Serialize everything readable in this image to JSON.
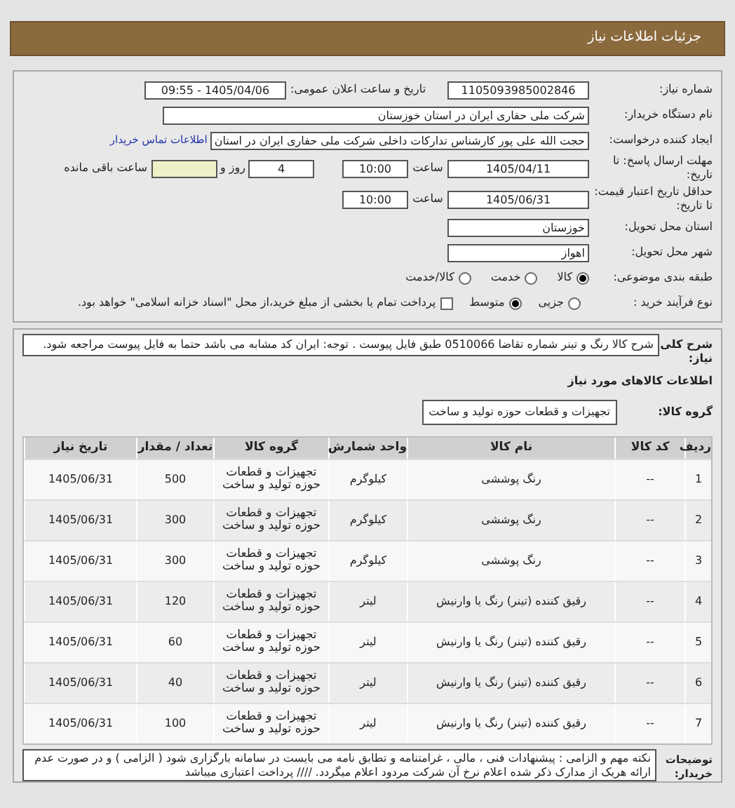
{
  "header": {
    "title": "جزئیات اطلاعات نیاز"
  },
  "details": {
    "need_number": {
      "label": "شماره نیاز:",
      "value": "1105093985002846"
    },
    "announce": {
      "label": "تاریخ و ساعت اعلان عمومی:",
      "value": "1405/04/06 - 09:55"
    },
    "buyer": {
      "label": "نام دستگاه خریدار:",
      "value": "شرکت ملی حفاری ایران در استان خوزستان"
    },
    "creator": {
      "label": "ایجاد کننده درخواست:",
      "value": "حجت الله علی پور کارشناس تدارکات داخلی شرکت ملی حفاری ایران در استان",
      "link": "اطلاعات تماس خریدار"
    },
    "deadline": {
      "label": "مهلت ارسال پاسخ: تا تاریخ:",
      "date": "1405/04/11",
      "time_label": "ساعت",
      "time": "10:00",
      "days": "4",
      "days_label": "روز و",
      "remaining_label": "ساعت باقی مانده"
    },
    "validity": {
      "label": "حداقل تاریخ اعتبار قیمت: تا تاریخ:",
      "date": "1405/06/31",
      "time_label": "ساعت",
      "time": "10:00"
    },
    "province": {
      "label": "استان محل تحویل:",
      "value": "خوزستان"
    },
    "city": {
      "label": "شهر محل تحویل:",
      "value": "اهواز"
    },
    "category": {
      "label": "طبقه بندی موضوعی:",
      "options": [
        {
          "label": "کالا",
          "selected": true
        },
        {
          "label": "خدمت",
          "selected": false
        },
        {
          "label": "کالا/خدمت",
          "selected": false
        }
      ]
    },
    "process": {
      "label": "نوع فرآیند خرید :",
      "options": [
        {
          "label": "جزیی",
          "selected": false
        },
        {
          "label": "متوسط",
          "selected": true
        }
      ],
      "checkbox": {
        "checked": false,
        "text": "پرداخت تمام یا بخشی از مبلغ خرید،از محل \"اسناد خزانه اسلامی\" خواهد بود."
      }
    }
  },
  "description": {
    "label": "شرح کلی نیاز:",
    "text": "شرح کالا رنگ و تینر شماره تقاضا 0510066 طبق فایل پیوست . توجه: ایران کد مشابه می باشد حتما به فایل پیوست مراجعه شود."
  },
  "goods_title": "اطلاعات کالاهای مورد نیاز",
  "group": {
    "label": "گروه کالا:",
    "value": "تجهیزات و قطعات حوزه تولید و ساخت"
  },
  "table": {
    "columns": [
      "ردیف",
      "کد کالا",
      "نام کالا",
      "واحد شمارش",
      "گروه کالا",
      "تعداد / مقدار",
      "تاریخ نیاز"
    ],
    "rows": [
      [
        "1",
        "--",
        "رنگ پوششی",
        "کیلوگرم",
        "تجهیزات و قطعات حوزه تولید و ساخت",
        "500",
        "1405/06/31"
      ],
      [
        "2",
        "--",
        "رنگ پوششی",
        "کیلوگرم",
        "تجهیزات و قطعات حوزه تولید و ساخت",
        "300",
        "1405/06/31"
      ],
      [
        "3",
        "--",
        "رنگ پوششی",
        "کیلوگرم",
        "تجهیزات و قطعات حوزه تولید و ساخت",
        "300",
        "1405/06/31"
      ],
      [
        "4",
        "--",
        "رقیق کننده (تینر) رنگ یا وارنیش",
        "لیتر",
        "تجهیزات و قطعات حوزه تولید و ساخت",
        "120",
        "1405/06/31"
      ],
      [
        "5",
        "--",
        "رقیق کننده (تینر) رنگ یا وارنیش",
        "لیتر",
        "تجهیزات و قطعات حوزه تولید و ساخت",
        "60",
        "1405/06/31"
      ],
      [
        "6",
        "--",
        "رقیق کننده (تینر) رنگ یا وارنیش",
        "لیتر",
        "تجهیزات و قطعات حوزه تولید و ساخت",
        "40",
        "1405/06/31"
      ],
      [
        "7",
        "--",
        "رقیق کننده (تینر) رنگ یا وارنیش",
        "لیتر",
        "تجهیزات و قطعات حوزه تولید و ساخت",
        "100",
        "1405/06/31"
      ]
    ]
  },
  "notes": {
    "label": "توضیحات خریدار:",
    "text": "نکته مهم و الزامی : پیشنهادات فنی ، مالی ، غرامتنامه و تطابق نامه می بایست در سامانه بارگزاری شود ( الزامی ) و در صورت عدم ارائه هریک از مدارک ذکر شده اعلام نرخ آن شرکت مردود اعلام میگردد. //// پرداخت اعتباری میباشد"
  }
}
